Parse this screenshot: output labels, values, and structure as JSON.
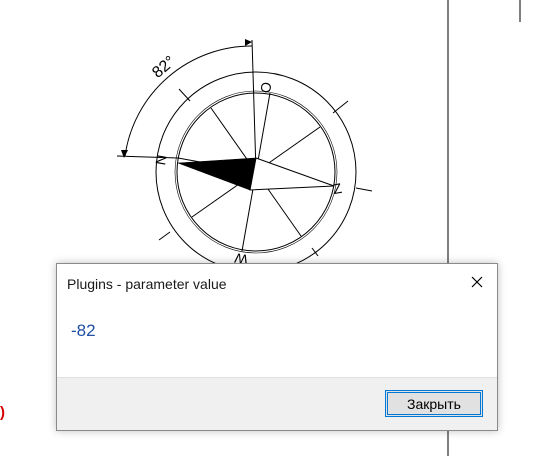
{
  "drawing": {
    "angle_label": "82°",
    "compass_letters": [
      "N",
      "O",
      "Z",
      "W"
    ],
    "partial_label": ")"
  },
  "dialog": {
    "title": "Plugins - parameter value",
    "value": "-82",
    "close_button_label": "Закрыть",
    "close_icon": "close-icon"
  },
  "colors": {
    "value_text": "#1f4ea3",
    "partial_label": "#d40000",
    "button_border": "#0078d7"
  }
}
